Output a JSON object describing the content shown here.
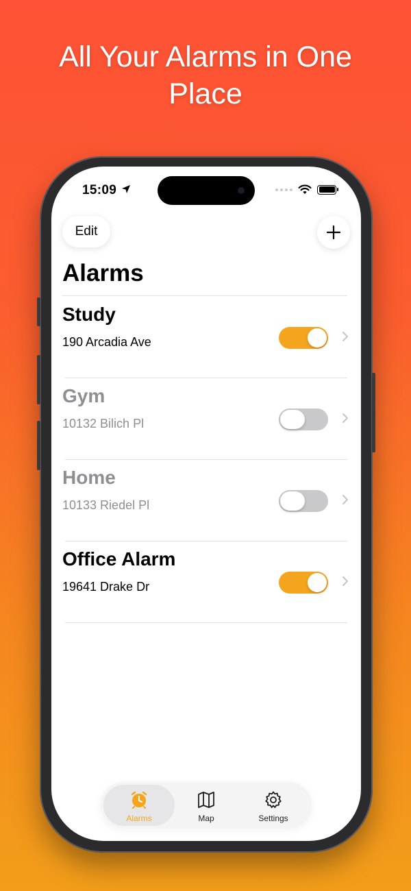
{
  "headline": {
    "line1": "All Your Alarms in One",
    "line2": "Place"
  },
  "status_bar": {
    "time": "15:09"
  },
  "nav": {
    "edit_label": "Edit",
    "title": "Alarms"
  },
  "alarms": [
    {
      "name": "Study",
      "address": "190 Arcadia Ave",
      "enabled": true
    },
    {
      "name": "Gym",
      "address": "10132 Bilich Pl",
      "enabled": false
    },
    {
      "name": "Home",
      "address": "10133 Riedel Pl",
      "enabled": false
    },
    {
      "name": "Office Alarm",
      "address": "19641 Drake Dr",
      "enabled": true
    }
  ],
  "tabbar": {
    "items": [
      {
        "label": "Alarms",
        "icon": "alarm-clock-icon",
        "selected": true
      },
      {
        "label": "Map",
        "icon": "map-icon",
        "selected": false
      },
      {
        "label": "Settings",
        "icon": "gear-icon",
        "selected": false
      }
    ]
  },
  "colors": {
    "accent": "#F5A51D",
    "bg_top": "#FF5135",
    "bg_bottom": "#F29E1A",
    "toggle_off": "#C9C9CC",
    "inactive_text": "#8E8E93"
  }
}
